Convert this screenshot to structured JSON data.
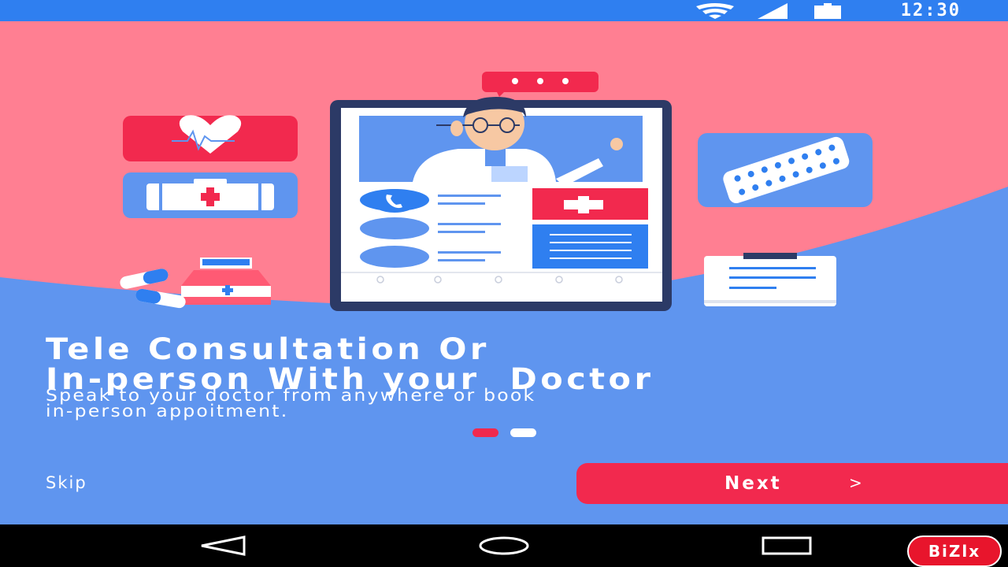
{
  "status_bar": {
    "time": "12:30",
    "icons": [
      "wifi-icon",
      "cell-signal-icon",
      "battery-icon"
    ]
  },
  "onboarding": {
    "title_line_1": "Tele Consultation Or",
    "title_line_2": "In-person With your  Doctor",
    "subtitle_line_1": "Speak to your doctor from anywhere or book",
    "subtitle_line_2": "in-person appoitment.",
    "page_indicator": {
      "current": 1,
      "total": 2
    }
  },
  "actions": {
    "skip_label": "Skip",
    "next_label": "Next",
    "next_chevron": ">"
  },
  "nav_bar": {
    "icons": [
      "back-icon",
      "home-icon",
      "recents-icon"
    ]
  },
  "brand": {
    "badge_text": "BiZlx"
  },
  "colors": {
    "status_bar": "#2f7ff0",
    "background_blue": "#5f95ef",
    "background_pink": "#ff7f92",
    "accent_red": "#f2294e",
    "nav_bar": "#000000"
  },
  "illustration_icons": [
    "heart-rate-icon",
    "first-aid-kit-icon",
    "pill-bottle-icon",
    "capsule-icon",
    "chat-bubble-icon",
    "doctor-avatar",
    "phone-icon",
    "medical-cross-icon",
    "pill-blister-icon",
    "clipboard-icon"
  ]
}
